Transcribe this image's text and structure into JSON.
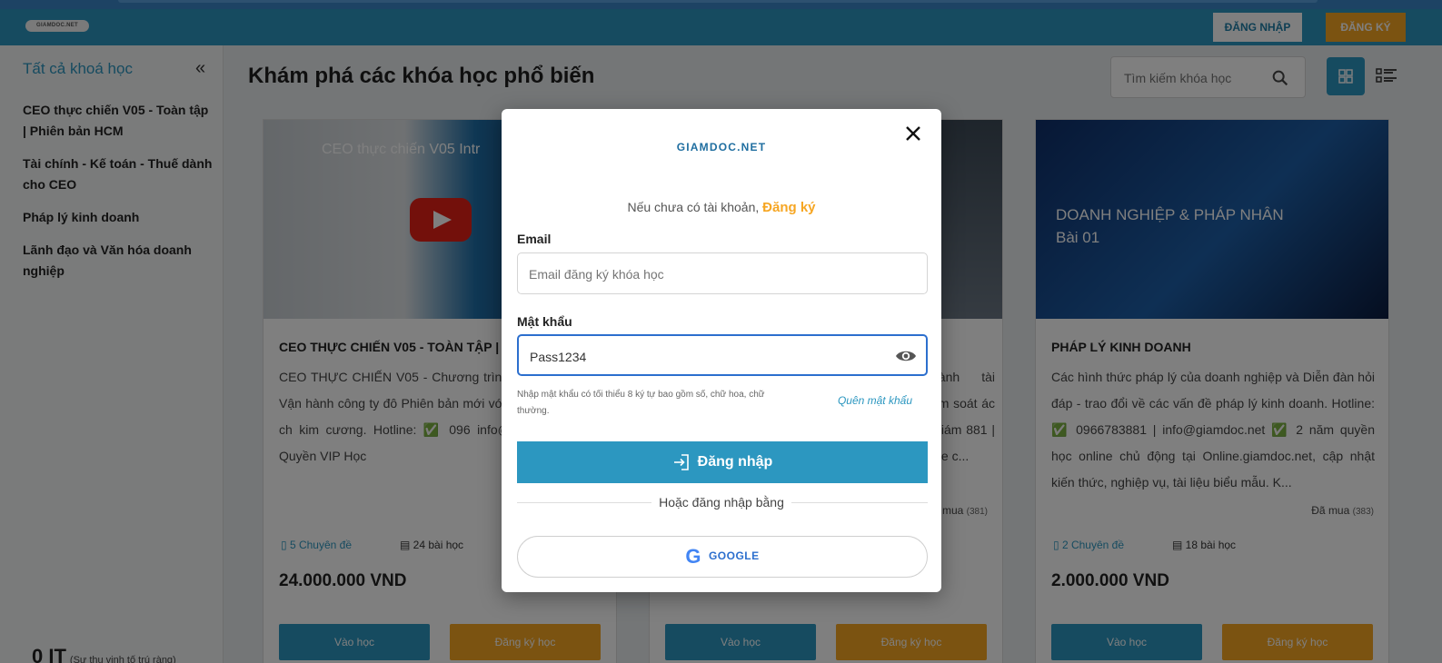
{
  "header": {
    "logo": "GIAMDOC.NET",
    "login_label": "ĐĂNG NHẬP",
    "register_label": "ĐĂNG KÝ"
  },
  "sidebar": {
    "title": "Tất cả khoá học",
    "collapse": "«",
    "items": [
      {
        "label": "CEO thực chiến V05 - Toàn tập | Phiên bản HCM"
      },
      {
        "label": "Tài chính - Kế toán - Thuế dành cho CEO"
      },
      {
        "label": "Pháp lý kinh doanh"
      },
      {
        "label": "Lãnh đạo và Văn hóa doanh nghiệp"
      }
    ],
    "footer_value": "0 IT",
    "footer_note": "(Sự thu vịnh tố trú ràng)"
  },
  "main": {
    "title": "Khám phá các khóa học phổ biến",
    "search_placeholder": "Tìm kiếm khóa học"
  },
  "cards": [
    {
      "thumb_text": "CEO thực chiến V05 Intr",
      "title": "CEO THỰC CHIẾN V05 - TOÀN TẬP | P",
      "desc": "CEO THỰC CHIẾN V05 - Chương trình đạo - Quản trị - Vận hành công ty đô Phiên bản mới với 5 cấu phần then ch kim cương. Hotline: ✅ 096 info@giamdoc.net ✅ Quyền VIP Học",
      "modules": "5 Chuyên đề",
      "lessons": "24 bài học",
      "price": "24.000.000 VND",
      "btn_learn": "Vào học",
      "btn_register": "Đăng ký học"
    },
    {
      "title": "",
      "desc": "hành tài ểm soát ác Giám 881 | ine c...",
      "bought": "mua",
      "bought_count": "(381)",
      "price": "",
      "btn_learn": "Vào học",
      "btn_register": "Đăng ký học"
    },
    {
      "thumb_text": "DOANH NGHIỆP & PHÁP NHÂN Bài 01",
      "title": "PHÁP LÝ KINH DOANH",
      "desc": "Các hình thức pháp lý của doanh nghiệp và Diễn đàn hỏi đáp - trao đổi về các vấn đề pháp lý kinh doanh. Hotline: ✅ 0966783881 | info@giamdoc.net ✅ 2 năm quyền học online chủ động tại Online.giamdoc.net, cập nhật kiến thức, nghiệp vụ, tài liệu biểu mẫu. K...",
      "bought": "Đã mua",
      "bought_count": "(383)",
      "modules": "2 Chuyên đề",
      "lessons": "18 bài học",
      "price": "2.000.000 VND",
      "btn_learn": "Vào học",
      "btn_register": "Đăng ký học"
    }
  ],
  "modal": {
    "logo": "GIAMDOC.NET",
    "no_account_text": "Nếu chưa có tài khoản,",
    "register_link": "Đăng ký",
    "email_label": "Email",
    "email_placeholder": "Email đăng ký khóa học",
    "password_label": "Mật khẩu",
    "password_value": "Pass1234",
    "password_hint": "Nhập mật khẩu có tối thiểu 8 ký tự bao gồm số, chữ hoa, chữ thường.",
    "forgot_link": "Quên mật khẩu",
    "login_button": "Đăng nhập",
    "or_text": "Hoặc đăng nhập bằng",
    "google_button": "GOOGLE"
  },
  "colors": {
    "primary": "#2c97c0",
    "accent": "#f6a623"
  },
  "icons": [
    "search-icon",
    "grid-view-icon",
    "list-view-icon",
    "close-icon",
    "eye-icon",
    "login-icon",
    "google-icon",
    "bookmark-icon",
    "book-icon",
    "play-icon"
  ]
}
